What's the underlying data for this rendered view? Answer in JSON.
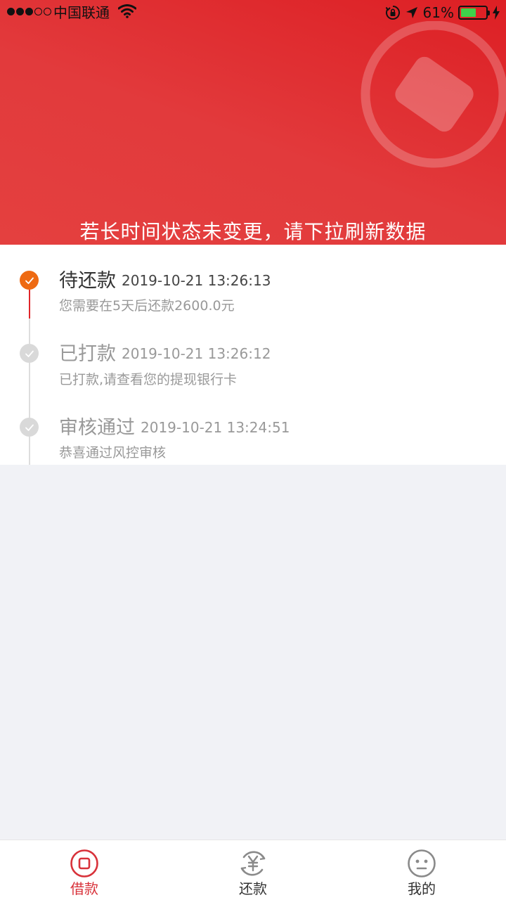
{
  "status_bar": {
    "carrier": "中国联通",
    "battery_percent": "61%",
    "battery_level": 0.61,
    "signal_bars_filled": 3,
    "signal_bars_total": 5
  },
  "header": {
    "tip": "若长时间状态未变更，请下拉刷新数据",
    "color": "#df2a2d"
  },
  "timeline": {
    "items": [
      {
        "title": "待还款",
        "time": "2019-10-21 13:26:13",
        "desc": "您需要在5天后还款2600.0元",
        "active": true
      },
      {
        "title": "已打款",
        "time": "2019-10-21 13:26:12",
        "desc": "已打款,请查看您的提现银行卡",
        "active": false
      },
      {
        "title": "审核通过",
        "time": "2019-10-21 13:24:51",
        "desc": "恭喜通过风控审核",
        "active": false
      }
    ],
    "colors": {
      "active_dot": "#ee6a12",
      "active_line": "#e0262a",
      "inactive_dot": "#d9d9d9",
      "inactive_line": "#dddddd",
      "active_title": "#333333",
      "active_time": "#444444",
      "inactive_text": "#999999"
    }
  },
  "tabbar": {
    "tabs": [
      {
        "label": "借款",
        "icon": "loan-icon",
        "selected": true
      },
      {
        "label": "还款",
        "icon": "repay-yuan-icon",
        "selected": false
      },
      {
        "label": "我的",
        "icon": "profile-face-icon",
        "selected": false
      }
    ],
    "colors": {
      "selected": "#d8323a",
      "normal": "#333333",
      "icon_normal": "#8a8a8a"
    }
  }
}
